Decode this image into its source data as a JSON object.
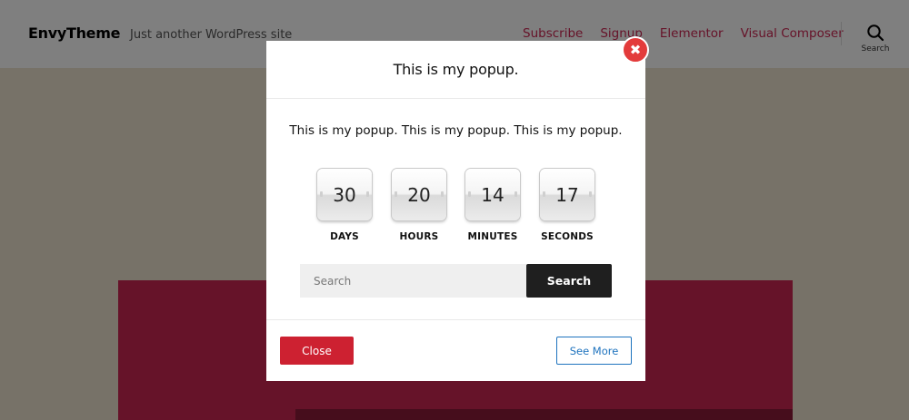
{
  "header": {
    "site_title": "EnvyTheme",
    "tagline": "Just another WordPress site",
    "nav": [
      "Subscribe",
      "Signup",
      "Elementor",
      "Visual Composer"
    ],
    "search_label": "Search",
    "search_icon": "search-icon"
  },
  "popup": {
    "title": "This is my popup.",
    "close_icon": "close-icon",
    "close_glyph": "✖",
    "text": "This is my popup. This is my popup. This is my popup.",
    "countdown": [
      {
        "value": "30",
        "label": "DAYS"
      },
      {
        "value": "20",
        "label": "HOURS"
      },
      {
        "value": "14",
        "label": "MINUTES"
      },
      {
        "value": "17",
        "label": "SECONDS"
      }
    ],
    "search": {
      "placeholder": "Search",
      "button": "Search"
    },
    "footer": {
      "close_label": "Close",
      "see_more_label": "See More"
    }
  },
  "colors": {
    "accent": "#cd2653",
    "close_button": "#cd2131",
    "link_button": "#1e73be",
    "search_button": "#1f1f1f"
  }
}
